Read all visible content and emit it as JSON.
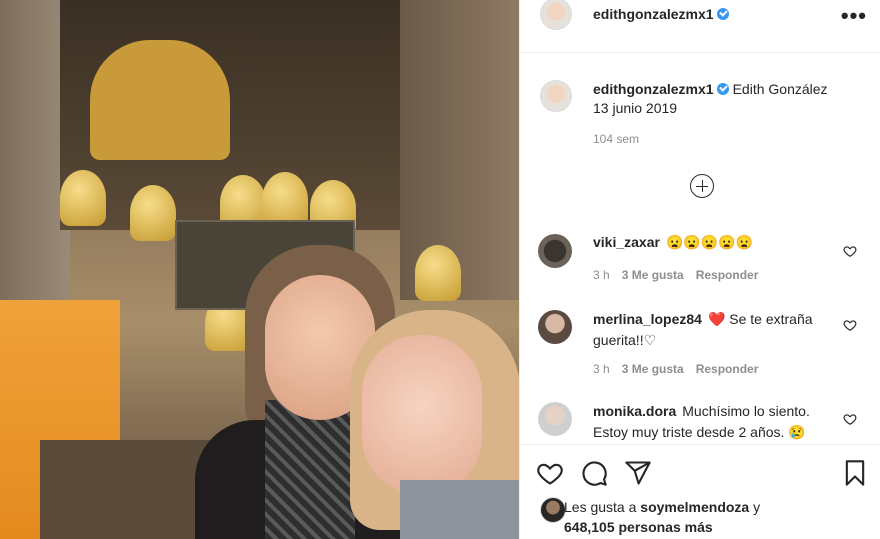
{
  "header": {
    "username": "edithgonzalezmx1",
    "more_label": "•••"
  },
  "caption": {
    "username": "edithgonzalezmx1",
    "text": "Edith González",
    "date": "13 junio 2019",
    "time_ago": "104 sem"
  },
  "comments": [
    {
      "username": "viki_zaxar",
      "text": "😦😦😦😦😦",
      "time": "3 h",
      "likes": "3 Me gusta",
      "reply": "Responder"
    },
    {
      "username": "merlina_lopez84",
      "text": "❤️ Se te extraña guerita!!♡",
      "time": "3 h",
      "likes": "3 Me gusta",
      "reply": "Responder"
    },
    {
      "username": "monika.dora",
      "text": "Muchísimo lo siento. Estoy muy triste desde 2 años. 😢"
    }
  ],
  "likes": {
    "prefix": "Les gusta a",
    "user": "soymelmendoza",
    "middle": "y",
    "count": "648,105 personas más"
  },
  "colors": {
    "verified": "#3897f0",
    "heart_red": "#ed4956",
    "text": "#262626",
    "muted": "#8e8e8e"
  }
}
